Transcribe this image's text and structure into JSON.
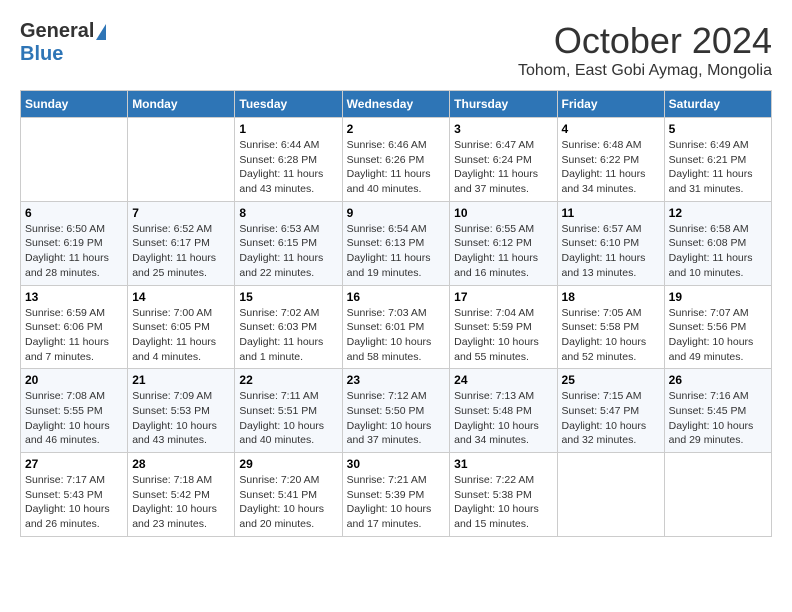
{
  "header": {
    "logo_general": "General",
    "logo_blue": "Blue",
    "month_title": "October 2024",
    "subtitle": "Tohom, East Gobi Aymag, Mongolia"
  },
  "calendar": {
    "days_of_week": [
      "Sunday",
      "Monday",
      "Tuesday",
      "Wednesday",
      "Thursday",
      "Friday",
      "Saturday"
    ],
    "weeks": [
      [
        {
          "day": "",
          "info": ""
        },
        {
          "day": "",
          "info": ""
        },
        {
          "day": "1",
          "info": "Sunrise: 6:44 AM\nSunset: 6:28 PM\nDaylight: 11 hours and 43 minutes."
        },
        {
          "day": "2",
          "info": "Sunrise: 6:46 AM\nSunset: 6:26 PM\nDaylight: 11 hours and 40 minutes."
        },
        {
          "day": "3",
          "info": "Sunrise: 6:47 AM\nSunset: 6:24 PM\nDaylight: 11 hours and 37 minutes."
        },
        {
          "day": "4",
          "info": "Sunrise: 6:48 AM\nSunset: 6:22 PM\nDaylight: 11 hours and 34 minutes."
        },
        {
          "day": "5",
          "info": "Sunrise: 6:49 AM\nSunset: 6:21 PM\nDaylight: 11 hours and 31 minutes."
        }
      ],
      [
        {
          "day": "6",
          "info": "Sunrise: 6:50 AM\nSunset: 6:19 PM\nDaylight: 11 hours and 28 minutes."
        },
        {
          "day": "7",
          "info": "Sunrise: 6:52 AM\nSunset: 6:17 PM\nDaylight: 11 hours and 25 minutes."
        },
        {
          "day": "8",
          "info": "Sunrise: 6:53 AM\nSunset: 6:15 PM\nDaylight: 11 hours and 22 minutes."
        },
        {
          "day": "9",
          "info": "Sunrise: 6:54 AM\nSunset: 6:13 PM\nDaylight: 11 hours and 19 minutes."
        },
        {
          "day": "10",
          "info": "Sunrise: 6:55 AM\nSunset: 6:12 PM\nDaylight: 11 hours and 16 minutes."
        },
        {
          "day": "11",
          "info": "Sunrise: 6:57 AM\nSunset: 6:10 PM\nDaylight: 11 hours and 13 minutes."
        },
        {
          "day": "12",
          "info": "Sunrise: 6:58 AM\nSunset: 6:08 PM\nDaylight: 11 hours and 10 minutes."
        }
      ],
      [
        {
          "day": "13",
          "info": "Sunrise: 6:59 AM\nSunset: 6:06 PM\nDaylight: 11 hours and 7 minutes."
        },
        {
          "day": "14",
          "info": "Sunrise: 7:00 AM\nSunset: 6:05 PM\nDaylight: 11 hours and 4 minutes."
        },
        {
          "day": "15",
          "info": "Sunrise: 7:02 AM\nSunset: 6:03 PM\nDaylight: 11 hours and 1 minute."
        },
        {
          "day": "16",
          "info": "Sunrise: 7:03 AM\nSunset: 6:01 PM\nDaylight: 10 hours and 58 minutes."
        },
        {
          "day": "17",
          "info": "Sunrise: 7:04 AM\nSunset: 5:59 PM\nDaylight: 10 hours and 55 minutes."
        },
        {
          "day": "18",
          "info": "Sunrise: 7:05 AM\nSunset: 5:58 PM\nDaylight: 10 hours and 52 minutes."
        },
        {
          "day": "19",
          "info": "Sunrise: 7:07 AM\nSunset: 5:56 PM\nDaylight: 10 hours and 49 minutes."
        }
      ],
      [
        {
          "day": "20",
          "info": "Sunrise: 7:08 AM\nSunset: 5:55 PM\nDaylight: 10 hours and 46 minutes."
        },
        {
          "day": "21",
          "info": "Sunrise: 7:09 AM\nSunset: 5:53 PM\nDaylight: 10 hours and 43 minutes."
        },
        {
          "day": "22",
          "info": "Sunrise: 7:11 AM\nSunset: 5:51 PM\nDaylight: 10 hours and 40 minutes."
        },
        {
          "day": "23",
          "info": "Sunrise: 7:12 AM\nSunset: 5:50 PM\nDaylight: 10 hours and 37 minutes."
        },
        {
          "day": "24",
          "info": "Sunrise: 7:13 AM\nSunset: 5:48 PM\nDaylight: 10 hours and 34 minutes."
        },
        {
          "day": "25",
          "info": "Sunrise: 7:15 AM\nSunset: 5:47 PM\nDaylight: 10 hours and 32 minutes."
        },
        {
          "day": "26",
          "info": "Sunrise: 7:16 AM\nSunset: 5:45 PM\nDaylight: 10 hours and 29 minutes."
        }
      ],
      [
        {
          "day": "27",
          "info": "Sunrise: 7:17 AM\nSunset: 5:43 PM\nDaylight: 10 hours and 26 minutes."
        },
        {
          "day": "28",
          "info": "Sunrise: 7:18 AM\nSunset: 5:42 PM\nDaylight: 10 hours and 23 minutes."
        },
        {
          "day": "29",
          "info": "Sunrise: 7:20 AM\nSunset: 5:41 PM\nDaylight: 10 hours and 20 minutes."
        },
        {
          "day": "30",
          "info": "Sunrise: 7:21 AM\nSunset: 5:39 PM\nDaylight: 10 hours and 17 minutes."
        },
        {
          "day": "31",
          "info": "Sunrise: 7:22 AM\nSunset: 5:38 PM\nDaylight: 10 hours and 15 minutes."
        },
        {
          "day": "",
          "info": ""
        },
        {
          "day": "",
          "info": ""
        }
      ]
    ]
  }
}
